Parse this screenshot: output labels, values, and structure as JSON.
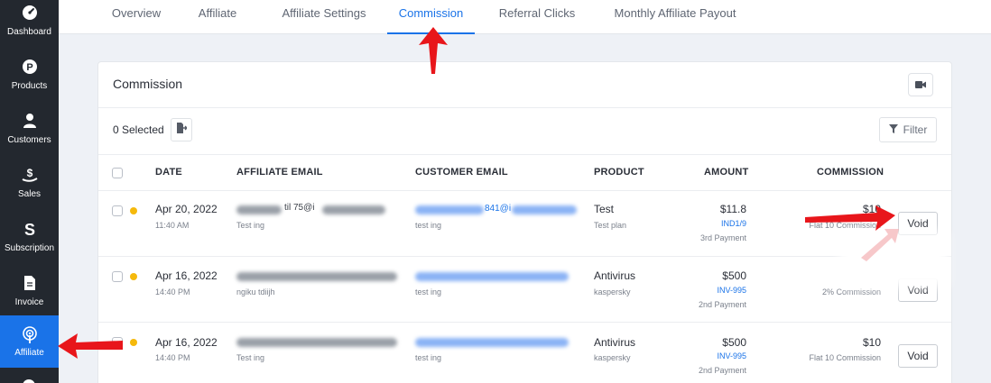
{
  "sidebar": {
    "items": [
      {
        "label": "Dashboard",
        "icon": "speedometer-icon"
      },
      {
        "label": "Products",
        "icon": "product-p-icon"
      },
      {
        "label": "Customers",
        "icon": "user-icon"
      },
      {
        "label": "Sales",
        "icon": "dollar-hand-icon"
      },
      {
        "label": "Subscription",
        "icon": "subscription-s-icon"
      },
      {
        "label": "Invoice",
        "icon": "document-icon"
      },
      {
        "label": "Affiliate",
        "icon": "broadcast-icon"
      }
    ],
    "active": "Affiliate"
  },
  "tabs": [
    {
      "label": "Overview"
    },
    {
      "label": "Affiliate"
    },
    {
      "label": "Affiliate Settings"
    },
    {
      "label": "Commission"
    },
    {
      "label": "Referral Clicks"
    },
    {
      "label": "Monthly Affiliate Payout"
    }
  ],
  "card": {
    "title": "Commission",
    "selected_text": "0 Selected",
    "filter_label": "Filter",
    "columns": [
      "DATE",
      "AFFILIATE EMAIL",
      "CUSTOMER EMAIL",
      "PRODUCT",
      "AMOUNT",
      "COMMISSION"
    ],
    "rows": [
      {
        "date": "Apr 20, 2022",
        "time": "11:40 AM",
        "affiliate_email_visible": "til 75@i",
        "affiliate_name": "Test ing",
        "customer_email_visible": "841@i",
        "customer_name": "test ing",
        "product": "Test",
        "plan": "Test plan",
        "amount": "$11.8",
        "invoice": "IND1/9",
        "payment": "3rd Payment",
        "commission": "$10",
        "commission_type": "Flat 10 Commission",
        "status_color": "#f5b90c",
        "action": "Void"
      },
      {
        "date": "Apr 16, 2022",
        "time": "14:40 PM",
        "affiliate_name": "ngiku tdiijh",
        "customer_name": "test ing",
        "product": "Antivirus",
        "plan": "kaspersky",
        "amount": "$500",
        "invoice": "INV-995",
        "payment": "2nd Payment",
        "commission_type": "2% Commission",
        "status_color": "#f5b90c",
        "action": "Void"
      },
      {
        "date": "Apr 16, 2022",
        "time": "14:40 PM",
        "affiliate_name": "Test ing",
        "customer_name": "test ing",
        "product": "Antivirus",
        "plan": "kaspersky",
        "amount": "$500",
        "invoice": "INV-995",
        "payment": "2nd Payment",
        "commission": "$10",
        "commission_type": "Flat 10 Commission",
        "status_color": "#f5b90c",
        "action": "Void"
      }
    ]
  },
  "colors": {
    "accent": "#1a73e8",
    "sidebar_bg": "#23282f",
    "arrow": "#e8161b",
    "status_pending": "#f5b90c"
  }
}
